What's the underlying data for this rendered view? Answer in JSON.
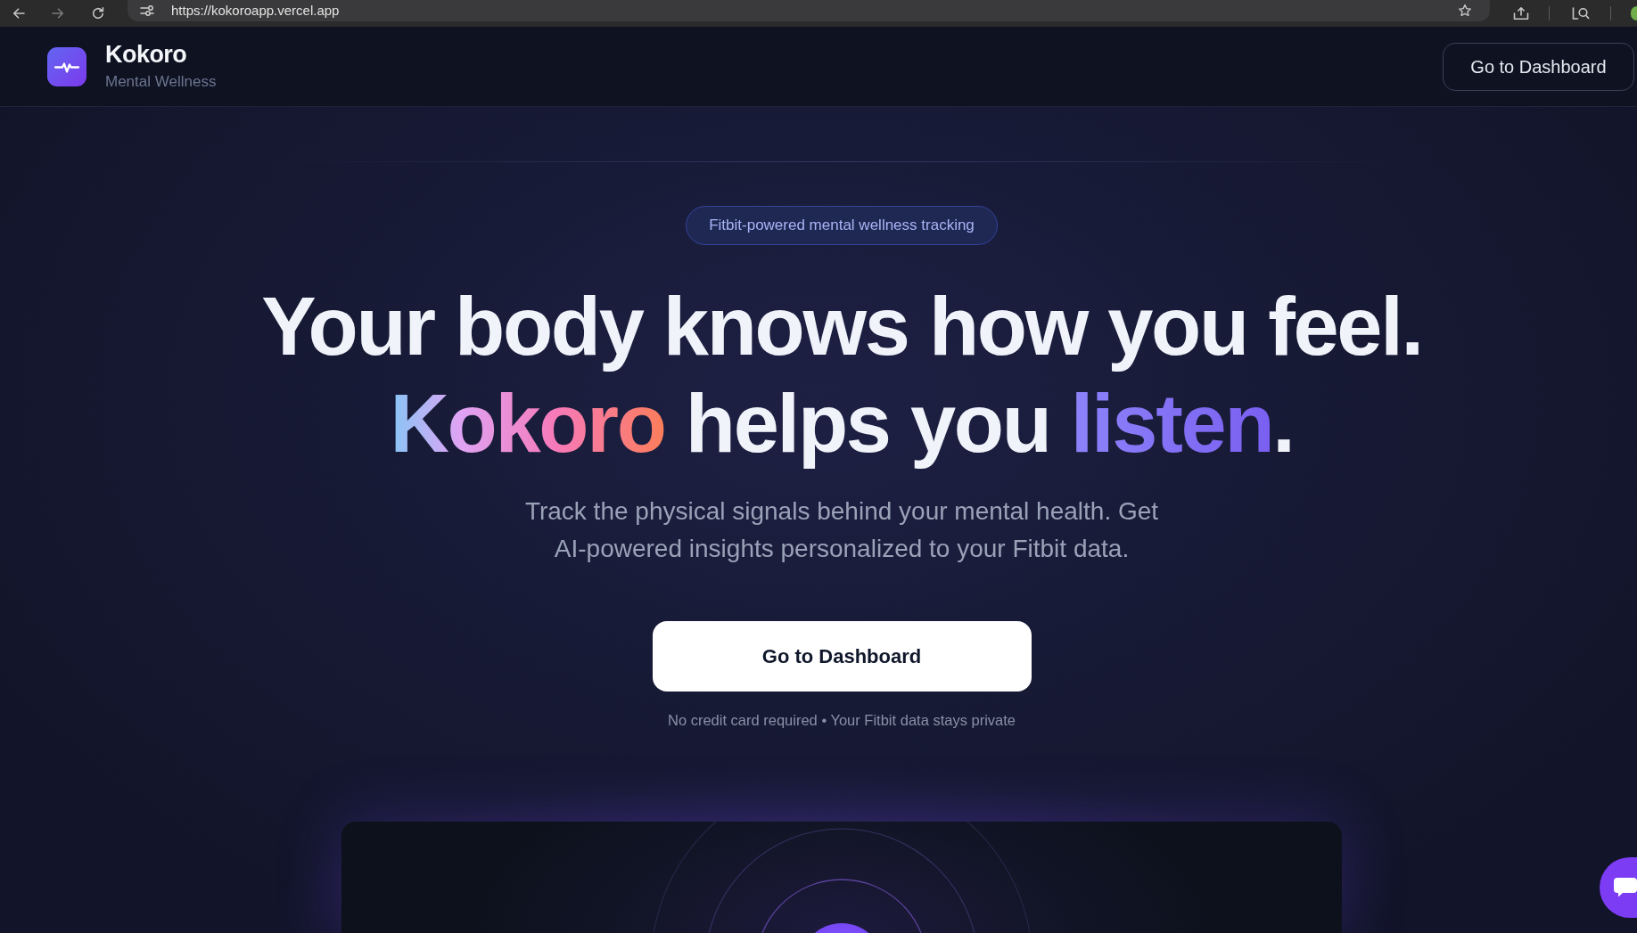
{
  "browser": {
    "url": "https://kokoroapp.vercel.app"
  },
  "header": {
    "brand_name": "Kokoro",
    "tagline": "Mental Wellness",
    "button": "Go to Dashboard"
  },
  "hero": {
    "tag": "Fitbit-powered mental wellness tracking",
    "headline": [
      [
        {
          "text": "Your body knows how you feel.",
          "kind": "plain"
        }
      ],
      [
        {
          "text": "Kokoro",
          "kind": "gradient"
        },
        {
          "text": " helps you ",
          "kind": "plain"
        },
        {
          "text": "listen",
          "kind": "accent"
        },
        {
          "text": ".",
          "kind": "plain"
        }
      ]
    ],
    "subtitle": "Track the physical signals behind your mental health. Get AI-powered insights personalized to your Fitbit data.",
    "button": "Go to Dashboard",
    "note": "No credit card required • Your Fitbit data stays private"
  }
}
